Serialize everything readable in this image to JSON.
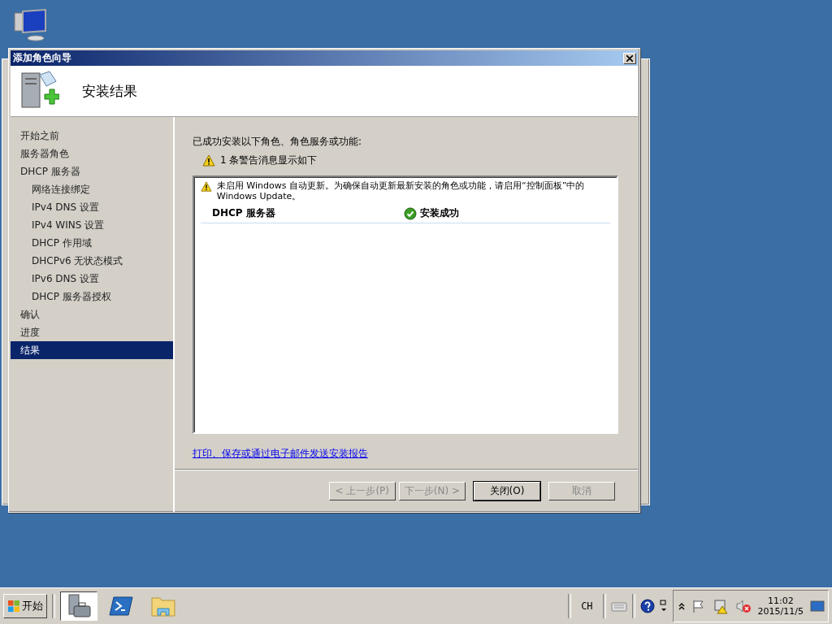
{
  "window": {
    "title": "添加角色向导"
  },
  "header": {
    "title": "安装结果"
  },
  "steps": [
    {
      "label": "开始之前",
      "selected": false
    },
    {
      "label": "服务器角色",
      "selected": false
    },
    {
      "label": "DHCP 服务器",
      "selected": false,
      "children": [
        {
          "label": "网络连接绑定",
          "selected": false
        },
        {
          "label": "IPv4 DNS 设置",
          "selected": false
        },
        {
          "label": "IPv4 WINS 设置",
          "selected": false
        },
        {
          "label": "DHCP 作用域",
          "selected": false
        },
        {
          "label": "DHCPv6 无状态模式",
          "selected": false
        },
        {
          "label": "IPv6 DNS 设置",
          "selected": false
        },
        {
          "label": "DHCP 服务器授权",
          "selected": false
        }
      ]
    },
    {
      "label": "确认",
      "selected": false
    },
    {
      "label": "进度",
      "selected": false
    },
    {
      "label": "结果",
      "selected": true
    }
  ],
  "content": {
    "intro": "已成功安装以下角色、角色服务或功能:",
    "warning_summary": "1 条警告消息显示如下",
    "messages": [
      {
        "kind": "warning",
        "text": "未启用 Windows 自动更新。为确保自动更新最新安装的角色或功能，请启用“控制面板”中的 Windows Update。"
      }
    ],
    "results": [
      {
        "role": "DHCP 服务器",
        "status": "安装成功",
        "kind": "success"
      }
    ],
    "report_link": "打印、保存或通过电子邮件发送安装报告"
  },
  "buttons": [
    {
      "label": "< 上一步(P)",
      "disabled": true,
      "default": false
    },
    {
      "label": "下一步(N) >",
      "disabled": true,
      "default": false
    },
    {
      "label": "关闭(O)",
      "disabled": false,
      "default": true
    },
    {
      "label": "取消",
      "disabled": true,
      "default": false
    }
  ],
  "taskbar": {
    "start": "开始",
    "apps": [
      {
        "kind": "server-manager",
        "selected": true
      },
      {
        "kind": "powershell",
        "selected": false
      },
      {
        "kind": "explorer",
        "selected": false
      }
    ],
    "language": "CH",
    "time": "11:02",
    "date": "2015/11/5"
  }
}
